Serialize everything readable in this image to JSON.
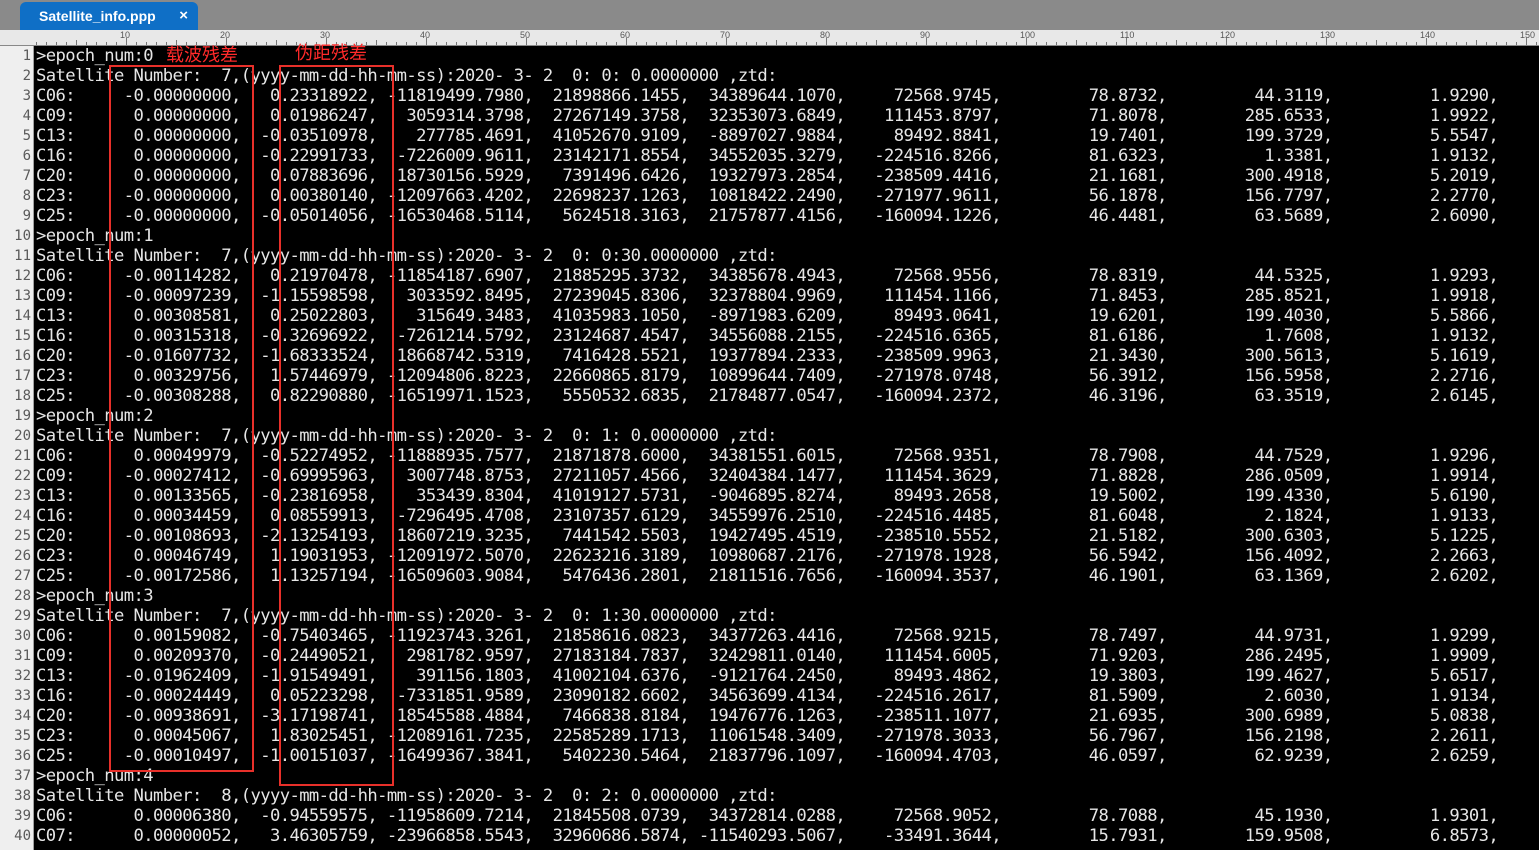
{
  "tab": {
    "title": "Satellite_info.ppp",
    "close_glyph": "×"
  },
  "ruler_labels": [
    "10",
    "20",
    "30",
    "40",
    "50",
    "60",
    "70",
    "80",
    "90",
    "100",
    "110",
    "120",
    "130",
    "140",
    "150"
  ],
  "annotations": {
    "carrier_residual": "载波残差",
    "pseudorange_residual": "伪距残差"
  },
  "lines": [
    ">epoch_num:0",
    "Satellite Number:  7,(yyyy-mm-dd-hh-mm-ss):2020- 3- 2  0: 0: 0.0000000 ,ztd:",
    "C06:     -0.00000000,   0.23318922, -11819499.7980,  21898866.1455,  34389644.1070,     72568.9745,         78.8732,         44.3119,          1.9290,",
    "C09:      0.00000000,   0.01986247,   3059314.3798,  27267149.3758,  32353073.6849,    111453.8797,         71.8078,        285.6533,          1.9922,",
    "C13:      0.00000000,  -0.03510978,    277785.4691,  41052670.9109,  -8897027.9884,     89492.8841,         19.7401,        199.3729,          5.5547,",
    "C16:      0.00000000,  -0.22991733,  -7226009.9611,  23142171.8554,  34552035.3279,   -224516.8266,         81.6323,          1.3381,          1.9132,",
    "C20:      0.00000000,   0.07883696,  18730156.5929,   7391496.6426,  19327973.2854,   -238509.4416,         21.1681,        300.4918,          5.2019,",
    "C23:     -0.00000000,   0.00380140, -12097663.4202,  22698237.1263,  10818422.2490,   -271977.9611,         56.1878,        156.7797,          2.2770,",
    "C25:     -0.00000000,  -0.05014056, -16530468.5114,   5624518.3163,  21757877.4156,   -160094.1226,         46.4481,         63.5689,          2.6090,",
    ">epoch_num:1",
    "Satellite Number:  7,(yyyy-mm-dd-hh-mm-ss):2020- 3- 2  0: 0:30.0000000 ,ztd:",
    "C06:     -0.00114282,   0.21970478, -11854187.6907,  21885295.3732,  34385678.4943,     72568.9556,         78.8319,         44.5325,          1.9293,",
    "C09:     -0.00097239,  -1.15598598,   3033592.8495,  27239045.8306,  32378804.9969,    111454.1166,         71.8453,        285.8521,          1.9918,",
    "C13:      0.00308581,   0.25022803,    315649.3483,  41035983.1050,  -8971983.6209,     89493.0641,         19.6201,        199.4030,          5.5866,",
    "C16:      0.00315318,  -0.32696922,  -7261214.5792,  23124687.4547,  34556088.2155,   -224516.6365,         81.6186,          1.7608,          1.9132,",
    "C20:     -0.01607732,  -1.68333524,  18668742.5319,   7416428.5521,  19377894.2333,   -238509.9963,         21.3430,        300.5613,          5.1619,",
    "C23:      0.00329756,   1.57446979, -12094806.8223,  22660865.8179,  10899644.7409,   -271978.0748,         56.3912,        156.5958,          2.2716,",
    "C25:     -0.00308288,   0.82290880, -16519971.1523,   5550532.6835,  21784877.0547,   -160094.2372,         46.3196,         63.3519,          2.6145,",
    ">epoch_num:2",
    "Satellite Number:  7,(yyyy-mm-dd-hh-mm-ss):2020- 3- 2  0: 1: 0.0000000 ,ztd:",
    "C06:      0.00049979,  -0.52274952, -11888935.7577,  21871878.6000,  34381551.6015,     72568.9351,         78.7908,         44.7529,          1.9296,",
    "C09:     -0.00027412,  -0.69995963,   3007748.8753,  27211057.4566,  32404384.1477,    111454.3629,         71.8828,        286.0509,          1.9914,",
    "C13:      0.00133565,  -0.23816958,    353439.8304,  41019127.5731,  -9046895.8274,     89493.2658,         19.5002,        199.4330,          5.6190,",
    "C16:      0.00034459,   0.08559913,  -7296495.4708,  23107357.6129,  34559976.2510,   -224516.4485,         81.6048,          2.1824,          1.9133,",
    "C20:     -0.00108693,  -2.13254193,  18607219.3235,   7441542.5503,  19427495.4519,   -238510.5552,         21.5182,        300.6303,          5.1225,",
    "C23:      0.00046749,   1.19031953, -12091972.5070,  22623216.3189,  10980687.2176,   -271978.1928,         56.5942,        156.4092,          2.2663,",
    "C25:     -0.00172586,   1.13257194, -16509603.9084,   5476436.2801,  21811516.7656,   -160094.3537,         46.1901,         63.1369,          2.6202,",
    ">epoch_num:3",
    "Satellite Number:  7,(yyyy-mm-dd-hh-mm-ss):2020- 3- 2  0: 1:30.0000000 ,ztd:",
    "C06:      0.00159082,  -0.75403465, -11923743.3261,  21858616.0823,  34377263.4416,     72568.9215,         78.7497,         44.9731,          1.9299,",
    "C09:      0.00209370,  -0.24490521,   2981782.9597,  27183184.7837,  32429811.0140,    111454.6005,         71.9203,        286.2495,          1.9909,",
    "C13:     -0.01962409,  -1.91549491,    391156.1803,  41002104.6376,  -9121764.2450,     89493.4862,         19.3803,        199.4627,          5.6517,",
    "C16:     -0.00024449,   0.05223298,  -7331851.9589,  23090182.6602,  34563699.4134,   -224516.2617,         81.5909,          2.6030,          1.9134,",
    "C20:     -0.00938691,  -3.17198741,  18545588.4884,   7466838.8184,  19476776.1263,   -238511.1077,         21.6935,        300.6989,          5.0838,",
    "C23:      0.00045067,   1.83025451, -12089161.7235,  22585289.1713,  11061548.3409,   -271978.3033,         56.7967,        156.2198,          2.2611,",
    "C25:     -0.00010497,  -1.00151037, -16499367.3841,   5402230.5464,  21837796.1097,   -160094.4703,         46.0597,         62.9239,          2.6259,",
    ">epoch_num:4",
    "Satellite Number:  8,(yyyy-mm-dd-hh-mm-ss):2020- 3- 2  0: 2: 0.0000000 ,ztd:",
    "C06:      0.00006380,  -0.94559575, -11958609.7214,  21845508.0739,  34372814.0288,     72568.9052,         78.7088,         45.1930,          1.9301,",
    "C07:      0.00000052,   3.46305759, -23966858.5543,  32960686.5874, -11540293.5067,    -33491.3644,         15.7931,        159.9508,          6.8573,"
  ]
}
